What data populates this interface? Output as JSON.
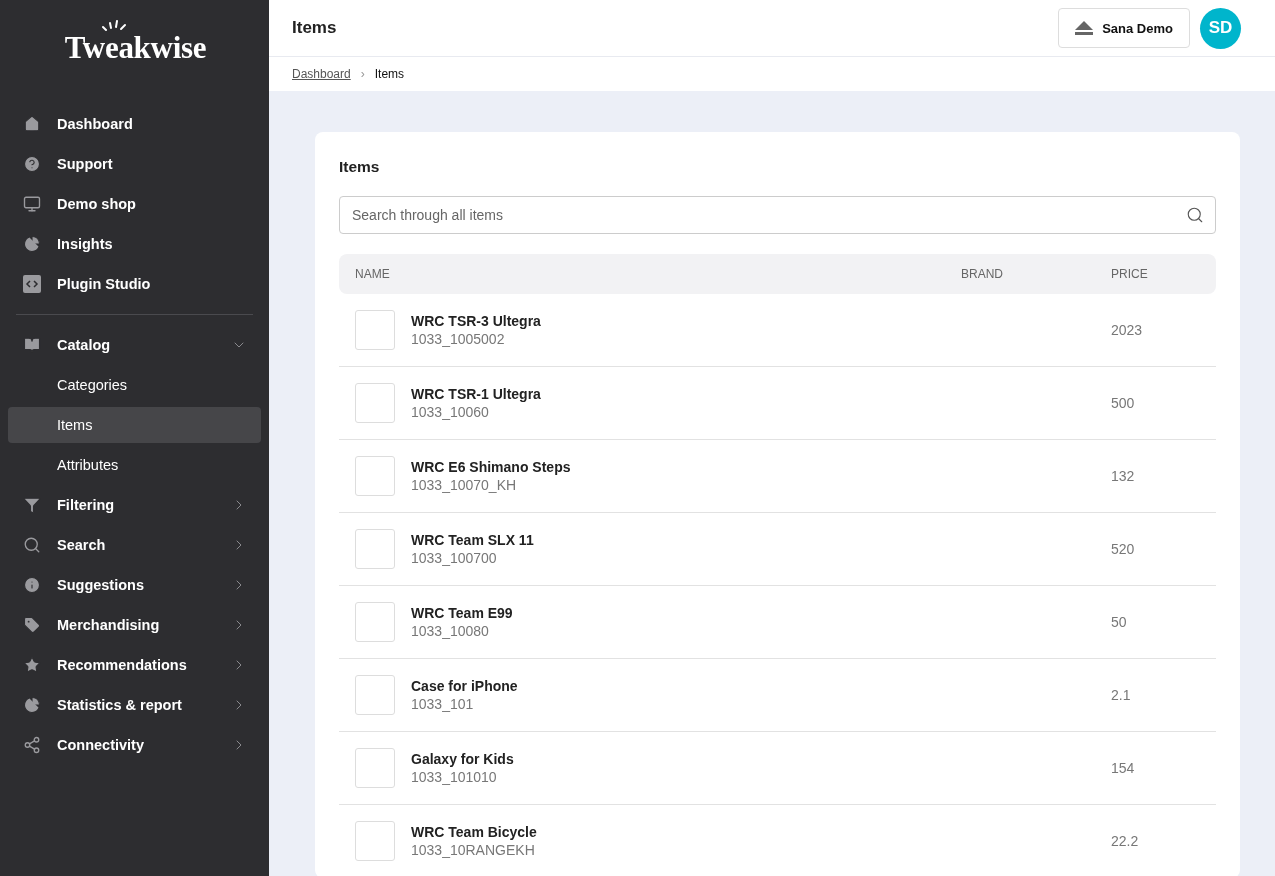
{
  "sidebar": {
    "logo": "Tweakwise",
    "groups": [
      {
        "items": [
          {
            "label": "Dashboard",
            "kind": "link"
          },
          {
            "label": "Support",
            "kind": "link"
          },
          {
            "label": "Demo shop",
            "kind": "link"
          },
          {
            "label": "Insights",
            "kind": "link"
          },
          {
            "label": "Plugin Studio",
            "kind": "link"
          }
        ]
      },
      {
        "items": [
          {
            "label": "Catalog",
            "kind": "parent",
            "expanded": true,
            "children": [
              {
                "label": "Categories",
                "selected": false
              },
              {
                "label": "Items",
                "selected": true
              },
              {
                "label": "Attributes",
                "selected": false
              }
            ]
          },
          {
            "label": "Filtering",
            "kind": "parent",
            "expanded": false
          },
          {
            "label": "Search",
            "kind": "parent",
            "expanded": false
          },
          {
            "label": "Suggestions",
            "kind": "parent",
            "expanded": false
          },
          {
            "label": "Merchandising",
            "kind": "parent",
            "expanded": false
          },
          {
            "label": "Recommendations",
            "kind": "parent",
            "expanded": false
          },
          {
            "label": "Statistics & report",
            "kind": "parent",
            "expanded": false
          },
          {
            "label": "Connectivity",
            "kind": "parent",
            "expanded": false
          }
        ]
      }
    ]
  },
  "header": {
    "title": "Items",
    "account": "Sana Demo",
    "avatar": "SD"
  },
  "breadcrumb": {
    "separator": "›",
    "items": [
      {
        "label": "Dashboard",
        "kind": "link"
      },
      {
        "label": "Items",
        "kind": "current"
      }
    ]
  },
  "card": {
    "title": "Items",
    "search": {
      "placeholder": "Search through all items"
    },
    "table": {
      "columns": [
        "NAME",
        "BRAND",
        "PRICE"
      ],
      "rows": [
        {
          "name": "WRC TSR-3 Ultegra",
          "sku": "1033_1005002",
          "price": "2023"
        },
        {
          "name": "WRC TSR-1 Ultegra",
          "sku": "1033_10060",
          "price": "500"
        },
        {
          "name": "WRC E6 Shimano Steps",
          "sku": "1033_10070_KH",
          "price": "132"
        },
        {
          "name": "WRC Team SLX 11",
          "sku": "1033_100700",
          "price": "520"
        },
        {
          "name": "WRC Team E99",
          "sku": "1033_10080",
          "price": "50"
        },
        {
          "name": "Case for iPhone",
          "sku": "1033_101",
          "price": "2.1"
        },
        {
          "name": "Galaxy for Kids",
          "sku": "1033_101010",
          "price": "154"
        },
        {
          "name": "WRC Team Bicycle",
          "sku": "1033_10RANGEKH",
          "price": "22.2"
        }
      ]
    }
  }
}
